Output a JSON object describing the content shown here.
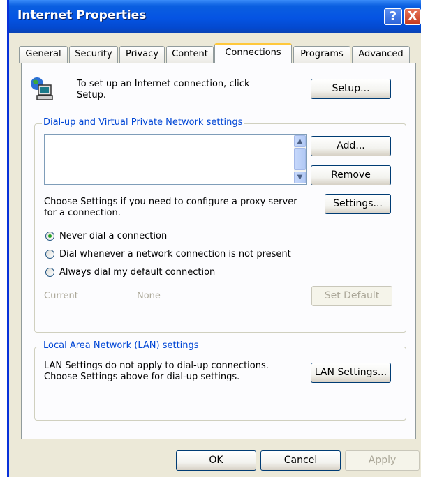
{
  "window": {
    "title": "Internet Properties",
    "help_glyph": "?",
    "close_glyph": "X"
  },
  "tabs": [
    {
      "label": "General"
    },
    {
      "label": "Security"
    },
    {
      "label": "Privacy"
    },
    {
      "label": "Content"
    },
    {
      "label": "Connections",
      "active": true
    },
    {
      "label": "Programs"
    },
    {
      "label": "Advanced"
    }
  ],
  "setup": {
    "text": "To set up an Internet connection, click Setup.",
    "button": "Setup..."
  },
  "dialup": {
    "legend": "Dial-up and Virtual Private Network settings",
    "add_button": "Add...",
    "remove_button": "Remove",
    "proxy_text": "Choose Settings if you need to configure a proxy server for a connection.",
    "settings_button": "Settings...",
    "options": [
      {
        "label": "Never dial a connection",
        "selected": true
      },
      {
        "label": "Dial whenever a network connection is not present",
        "selected": false
      },
      {
        "label": "Always dial my default connection",
        "selected": false
      }
    ],
    "current_label": "Current",
    "current_value": "None",
    "set_default_button": "Set Default"
  },
  "lan": {
    "legend": "Local Area Network (LAN) settings",
    "text": "LAN Settings do not apply to dial-up connections. Choose Settings above for dial-up settings.",
    "button": "LAN Settings..."
  },
  "footer": {
    "ok": "OK",
    "cancel": "Cancel",
    "apply": "Apply"
  },
  "icons": {
    "connection": "globe-computer-icon",
    "scroll_up": "▲",
    "scroll_down": "▼"
  },
  "colors": {
    "titlebar": "#0554e3",
    "legend_text": "#0046d5",
    "dialog_bg": "#ece9d8"
  }
}
